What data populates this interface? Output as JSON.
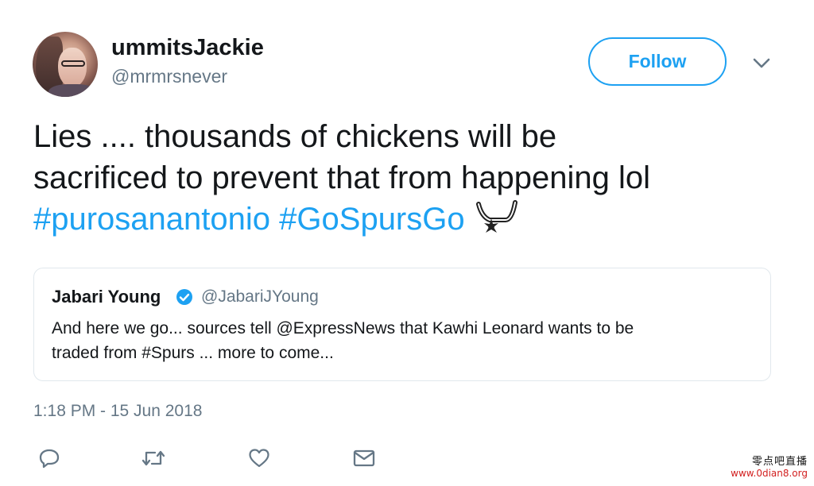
{
  "author": {
    "display_name": "ummitsJackie",
    "handle": "@mrmrsnever"
  },
  "header": {
    "follow_label": "Follow",
    "caret_icon": "chevron-down-icon"
  },
  "tweet": {
    "line1": "Lies .... thousands of chickens will be",
    "line2": "sacrificed to prevent that from happening lol",
    "hashtag1": "#purosanantonio",
    "hashtag2": "#GoSpursGo",
    "emoji_icon": "spurs-logo-icon"
  },
  "quoted": {
    "display_name": "Jabari Young",
    "handle": "@JabariJYoung",
    "verified_icon": "verified-badge-icon",
    "line1": "And here we go... sources tell @ExpressNews that Kawhi Leonard wants to be",
    "line2": "traded from #Spurs ... more to come..."
  },
  "timestamp": "1:18 PM - 15 Jun 2018",
  "actions": {
    "reply_icon": "reply-icon",
    "retweet_icon": "retweet-icon",
    "like_icon": "heart-icon",
    "dm_icon": "envelope-icon"
  },
  "watermark": {
    "top": "零点吧直播",
    "bottom": "www.0dian8.org"
  },
  "colors": {
    "accent": "#1da1f2",
    "secondary_text": "#657786",
    "primary_text": "#14171a",
    "border": "#e1e8ed"
  }
}
